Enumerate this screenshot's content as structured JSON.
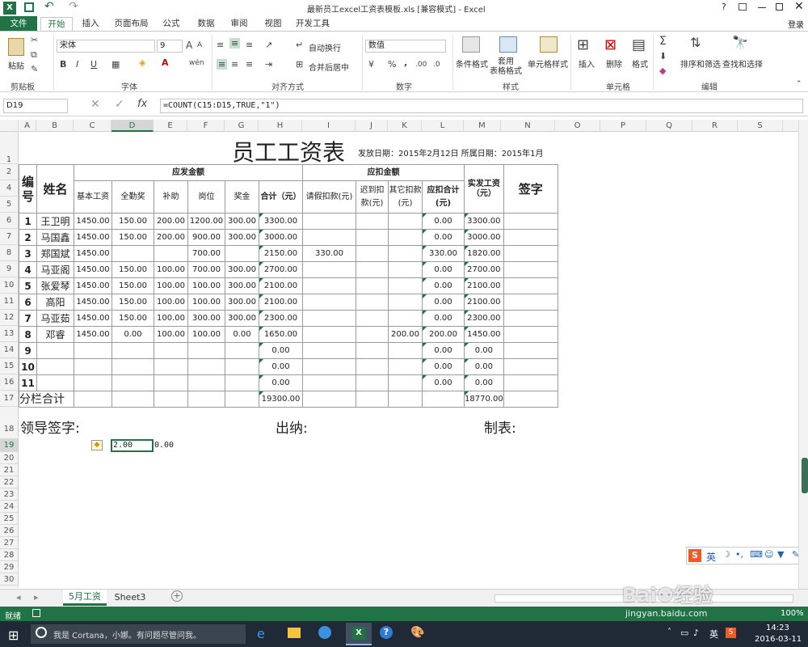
{
  "window": {
    "title": "最新员工excel工资表模板.xls  [兼容模式] - Excel",
    "help": "?",
    "login": "登录"
  },
  "ribbon_tabs": [
    "文件",
    "开始",
    "插入",
    "页面布局",
    "公式",
    "数据",
    "审阅",
    "视图",
    "开发工具"
  ],
  "ribbon": {
    "clipboard": {
      "paste": "粘贴",
      "group": "剪贴板"
    },
    "font": {
      "name": "宋体",
      "size": "9",
      "bold": "B",
      "italic": "I",
      "underline": "U",
      "wen": "wén",
      "group": "字体",
      "grow": "A",
      "shrink": "A"
    },
    "align": {
      "wrap": "自动换行",
      "merge": "合并后居中",
      "group": "对齐方式"
    },
    "number": {
      "format": "数值",
      "percent": "%",
      "comma": ",",
      "inc": ".00",
      "dec": ".0",
      "group": "数字"
    },
    "styles": {
      "conditional": "条件格式",
      "table": "套用\n表格格式",
      "cell": "单元格样式",
      "group": "样式"
    },
    "cells": {
      "insert": "插入",
      "delete": "删除",
      "format": "格式",
      "group": "单元格"
    },
    "editing": {
      "sort": "排序和筛选",
      "find": "查找和选择",
      "group": "编辑"
    }
  },
  "formula_bar": {
    "name_box": "D19",
    "fx": "fx",
    "formula": "=COUNT(C15:D15,TRUE,\"1\")"
  },
  "columns": [
    "A",
    "B",
    "C",
    "D",
    "E",
    "F",
    "G",
    "H",
    "I",
    "J",
    "K",
    "L",
    "M",
    "N",
    "O",
    "P",
    "Q",
    "R",
    "S"
  ],
  "rows": [
    "1",
    "2",
    "4",
    "5",
    "6",
    "7",
    "8",
    "9",
    "10",
    "11",
    "12",
    "13",
    "14",
    "15",
    "16",
    "17",
    "18",
    "19",
    "20",
    "21",
    "22",
    "23",
    "24",
    "25",
    "26",
    "27",
    "28",
    "29",
    "30"
  ],
  "sheet": {
    "title": "员工工资表",
    "issue_date": "发放日期：2015年2月12日 所属日期：2015年1月",
    "headers": {
      "id": "编号",
      "name": "姓名",
      "payable": "应发金额",
      "deduct": "应扣金额",
      "actual": "实发工资（元）",
      "sign": "签字",
      "base": "基本工资",
      "attendance": "全勤奖",
      "subsidy": "补助",
      "post": "岗位",
      "bonus": "奖金",
      "pay_total": "合计（元）",
      "leave": "请假扣款(元)",
      "late": "迟到扣款(元)",
      "other": "其它扣款(元)",
      "deduct_total": "应扣合计(元)"
    },
    "rows": [
      {
        "id": "1",
        "name": "王卫明",
        "base": "1450.00",
        "att": "150.00",
        "sub": "200.00",
        "post": "1200.00",
        "bonus": "300.00",
        "total": "3300.00",
        "leave": "",
        "late": "",
        "other": "",
        "ded": "0.00",
        "actual": "3300.00"
      },
      {
        "id": "2",
        "name": "马国鑫",
        "base": "1450.00",
        "att": "150.00",
        "sub": "200.00",
        "post": "900.00",
        "bonus": "300.00",
        "total": "3000.00",
        "leave": "",
        "late": "",
        "other": "",
        "ded": "0.00",
        "actual": "3000.00"
      },
      {
        "id": "3",
        "name": "郑国斌",
        "base": "1450.00",
        "att": "",
        "sub": "",
        "post": "700.00",
        "bonus": "",
        "total": "2150.00",
        "leave": "330.00",
        "late": "",
        "other": "",
        "ded": "330.00",
        "actual": "1820.00"
      },
      {
        "id": "4",
        "name": "马亚阁",
        "base": "1450.00",
        "att": "150.00",
        "sub": "100.00",
        "post": "700.00",
        "bonus": "300.00",
        "total": "2700.00",
        "leave": "",
        "late": "",
        "other": "",
        "ded": "0.00",
        "actual": "2700.00"
      },
      {
        "id": "5",
        "name": "张爱琴",
        "base": "1450.00",
        "att": "150.00",
        "sub": "100.00",
        "post": "100.00",
        "bonus": "300.00",
        "total": "2100.00",
        "leave": "",
        "late": "",
        "other": "",
        "ded": "0.00",
        "actual": "2100.00"
      },
      {
        "id": "6",
        "name": "高阳",
        "base": "1450.00",
        "att": "150.00",
        "sub": "100.00",
        "post": "100.00",
        "bonus": "300.00",
        "total": "2100.00",
        "leave": "",
        "late": "",
        "other": "",
        "ded": "0.00",
        "actual": "2100.00"
      },
      {
        "id": "7",
        "name": "马亚茹",
        "base": "1450.00",
        "att": "150.00",
        "sub": "100.00",
        "post": "300.00",
        "bonus": "300.00",
        "total": "2300.00",
        "leave": "",
        "late": "",
        "other": "",
        "ded": "0.00",
        "actual": "2300.00"
      },
      {
        "id": "8",
        "name": "邓睿",
        "base": "1450.00",
        "att": "0.00",
        "sub": "100.00",
        "post": "100.00",
        "bonus": "0.00",
        "total": "1650.00",
        "leave": "",
        "late": "",
        "other": "200.00",
        "ded": "200.00",
        "actual": "1450.00"
      },
      {
        "id": "9",
        "name": "",
        "base": "",
        "att": "",
        "sub": "",
        "post": "",
        "bonus": "",
        "total": "0.00",
        "leave": "",
        "late": "",
        "other": "",
        "ded": "0.00",
        "actual": "0.00"
      },
      {
        "id": "10",
        "name": "",
        "base": "",
        "att": "",
        "sub": "",
        "post": "",
        "bonus": "",
        "total": "0.00",
        "leave": "",
        "late": "",
        "other": "",
        "ded": "0.00",
        "actual": "0.00"
      },
      {
        "id": "11",
        "name": "",
        "base": "",
        "att": "",
        "sub": "",
        "post": "",
        "bonus": "",
        "total": "0.00",
        "leave": "",
        "late": "",
        "other": "",
        "ded": "0.00",
        "actual": "0.00"
      }
    ],
    "subtotal_label": "分栏合计",
    "subtotal_pay": "19300.00",
    "subtotal_actual": "18770.00",
    "footer": {
      "leader": "领导签字:",
      "cashier": "出纳:",
      "maker": "制表:"
    },
    "active_cell_value": "2.00",
    "next_cell_value": "0.00"
  },
  "sheet_tabs": [
    "5月工资",
    "Sheet3"
  ],
  "status": {
    "ready": "就绪",
    "zoom": "100%"
  },
  "ime": {
    "lang": "英"
  },
  "taskbar": {
    "cortana": "我是 Cortana，小娜。有问题尽管问我。",
    "time": "14:23",
    "date": "2016-03-11",
    "lang": "英"
  },
  "watermark": {
    "text": "jingyan.baidu.com"
  },
  "colors": {
    "excel_green": "#217346",
    "taskbar": "#1f2a36"
  }
}
